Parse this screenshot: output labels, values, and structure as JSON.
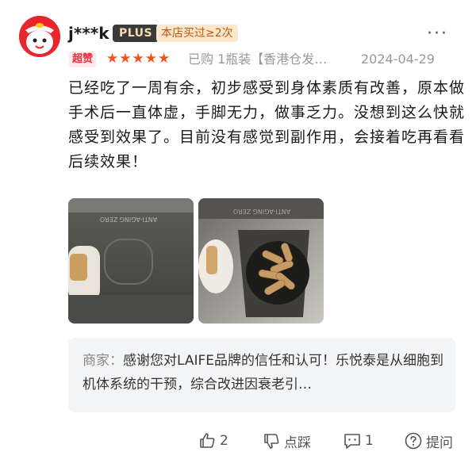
{
  "header": {
    "username": "j***k",
    "plus_badge": "PLUS",
    "repeat_badge": "本店买过≥2次",
    "more_label": "···",
    "super_tag": "超赞",
    "stars": [
      "★",
      "★",
      "★",
      "★",
      "★"
    ],
    "rating": 5,
    "purchase_info": "已购 1瓶装【香港仓发…",
    "date": "2024-04-29"
  },
  "review": {
    "text": "已经吃了一周有余，初步感受到身体素质有改善，原本做手术后一直体虚，手脚无力，做事乏力。没想到这么快就感受到效果了。目前没有感觉到副作用，会接着吃再看看后续效果！"
  },
  "photos": [
    {
      "label": "ANTI-AGING ZERO"
    },
    {
      "label": "ANTI-AGING ZERO"
    }
  ],
  "reply": {
    "label": "商家：",
    "text": "感谢您对LAIFE品牌的信任和认可！乐悦泰是从细胞到机体系统的干预，综合改进因衰老引…"
  },
  "actions": {
    "like_count": "2",
    "dislike_label": "点踩",
    "comment_count": "1",
    "ask_label": "提问"
  },
  "colors": {
    "star": "#f5511e",
    "super_tag_text": "#ef2b3e",
    "avatar_bg": "#e8262b"
  }
}
